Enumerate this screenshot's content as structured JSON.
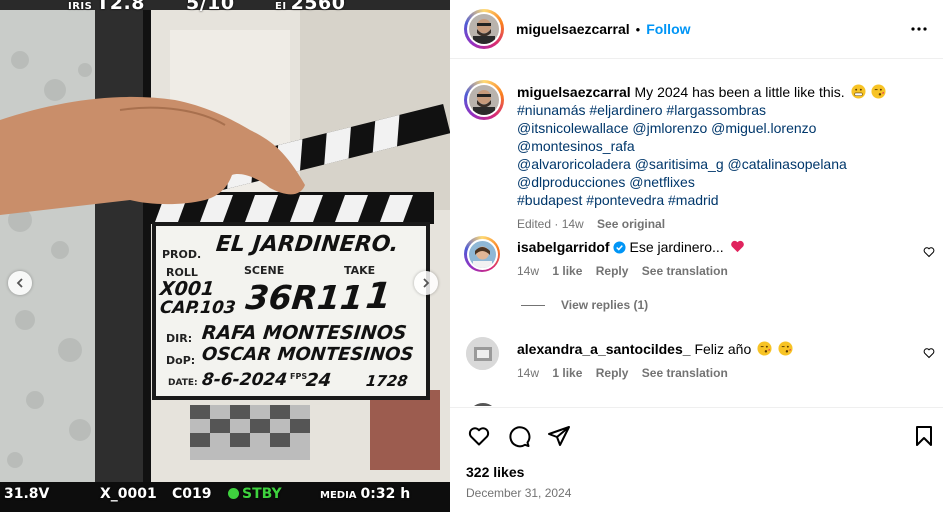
{
  "media": {
    "hud_top": [
      "IRIS",
      "T2.8",
      "5/10",
      "EI",
      "2560"
    ],
    "hud_bottom": {
      "level": "31.8V",
      "clip": "X_0001",
      "card": "C019",
      "status": "STBY",
      "media_label": "MEDIA",
      "media_time": "0:32 h"
    },
    "slate": {
      "prod_label": "PROD.",
      "prod_value": "EL JARDINERO.",
      "roll_label": "ROLL",
      "roll_value": "X001",
      "cap_value": "CAP.103",
      "scene_label": "SCENE",
      "scene_value": "36R11",
      "take_label": "TAKE",
      "take_value": "1",
      "dir_label": "DIR:",
      "dir_value": "RAFA MONTESINOS",
      "dop_label": "DoP:",
      "dop_value": "OSCAR MONTESINOS",
      "date_label": "DATE:",
      "date_value": "8-6-2024",
      "fps_label": "FPS",
      "fps_value": "24",
      "extra_value": "1728"
    }
  },
  "header": {
    "username": "miguelsaezcarral",
    "separator": "•",
    "follow_label": "Follow"
  },
  "caption": {
    "username": "miguelsaezcarral",
    "text": "My 2024 has been a little like this.",
    "tag_lines": [
      "#niunamás #eljardinero #largassombras",
      "@itsnicolewallace @jmlorenzo @miguel.lorenzo @montesinos_rafa",
      "@alvaroricoladera @saritisima_g @catalinasopelana",
      "@dlproducciones @netflixes",
      "#budapest #pontevedra #madrid"
    ],
    "edited": "Edited · 14w",
    "see_original": "See original"
  },
  "comments": [
    {
      "username": "isabelgarridof",
      "text": "Ese jardinero...",
      "age": "14w",
      "likes": "1 like",
      "reply": "Reply",
      "translate": "See translation"
    },
    {
      "username": "alexandra_a_santocildes_",
      "text": "Feliz año",
      "age": "14w",
      "likes": "1 like",
      "reply": "Reply",
      "translate": "See translation"
    }
  ],
  "view_replies": "View replies (1)",
  "likes": "322 likes",
  "date": "December 31, 2024",
  "colors": {
    "link_blue": "#00376b",
    "follow_blue": "#0095f6",
    "meta_grey": "#737373",
    "heart_red": "#e0245e",
    "stby_green": "#3ed13e"
  },
  "icons": [
    "heart-icon",
    "comment-icon",
    "share-icon",
    "save-icon",
    "more-options-icon",
    "verified-icon",
    "chevron-left-icon",
    "chevron-right-icon"
  ]
}
